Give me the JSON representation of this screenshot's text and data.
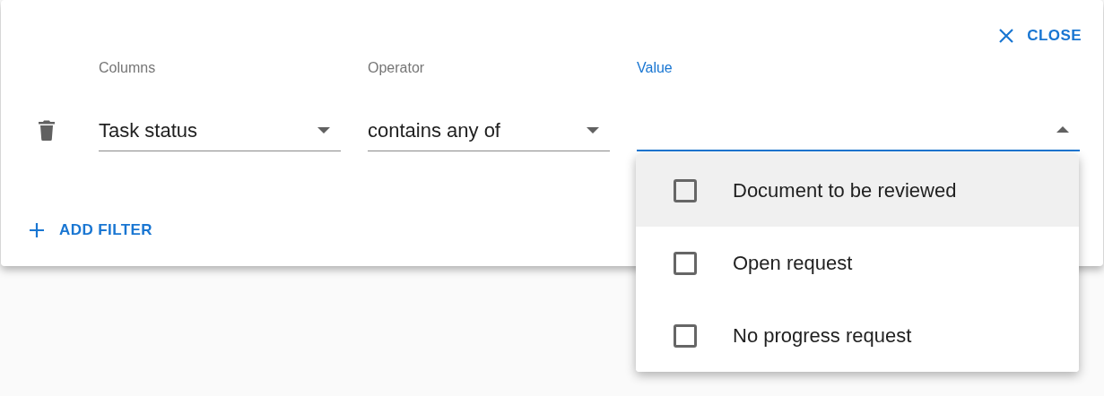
{
  "close_button": {
    "label": "CLOSE"
  },
  "filter": {
    "columns": {
      "label": "Columns",
      "value": "Task status"
    },
    "operator": {
      "label": "Operator",
      "value": "contains any of"
    },
    "value": {
      "label": "Value",
      "focused": true,
      "open": true
    }
  },
  "options": [
    {
      "label": "Document to be reviewed",
      "checked": false,
      "highlighted": true
    },
    {
      "label": "Open request",
      "checked": false,
      "highlighted": false
    },
    {
      "label": "No progress request",
      "checked": false,
      "highlighted": false
    }
  ],
  "add_filter": {
    "label": "ADD FILTER"
  }
}
